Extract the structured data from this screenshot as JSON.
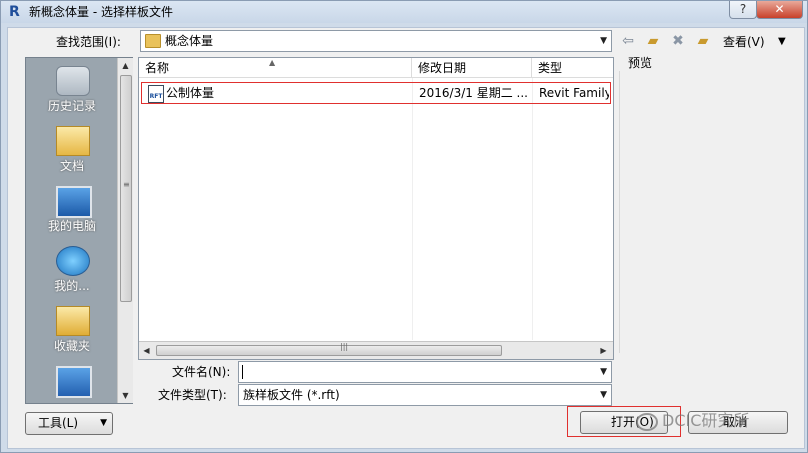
{
  "window": {
    "title": "新概念体量 - 选择样板文件",
    "app_icon_letter": "R",
    "help_label": "?",
    "close_label": "✕"
  },
  "lookin": {
    "label": "查找范围(I):",
    "value": "概念体量"
  },
  "toolbar": {
    "views_label": "查看(V)",
    "back_icon": "back-arrow-icon",
    "up_icon": "up-folder-icon",
    "delete_icon": "delete-icon",
    "new_folder_icon": "new-folder-icon"
  },
  "places": [
    {
      "label": "历史记录",
      "icon": "history-icon"
    },
    {
      "label": "文档",
      "icon": "documents-folder-icon"
    },
    {
      "label": "我的电脑",
      "icon": "computer-icon"
    },
    {
      "label": "我的...",
      "icon": "network-icon"
    },
    {
      "label": "收藏夹",
      "icon": "favorites-folder-icon"
    },
    {
      "label": "",
      "icon": "desktop-icon"
    }
  ],
  "file_list": {
    "columns": [
      "名称",
      "修改日期",
      "类型"
    ],
    "rows": [
      {
        "name": "公制体量",
        "date": "2016/3/1 星期二 ...",
        "type": "Revit Family"
      }
    ]
  },
  "preview_label": "预览",
  "file_name": {
    "label": "文件名(N):",
    "value": ""
  },
  "file_type": {
    "label": "文件类型(T):",
    "value": "族样板文件 (*.rft)"
  },
  "buttons": {
    "tools": "工具(L)",
    "open": "打开(O)",
    "cancel": "取消"
  },
  "watermark": "DCIC研究所",
  "colors": {
    "highlight_border": "#e0302e",
    "places_bg": "#9aa5ae",
    "window_frame": "#cfdbe9"
  }
}
